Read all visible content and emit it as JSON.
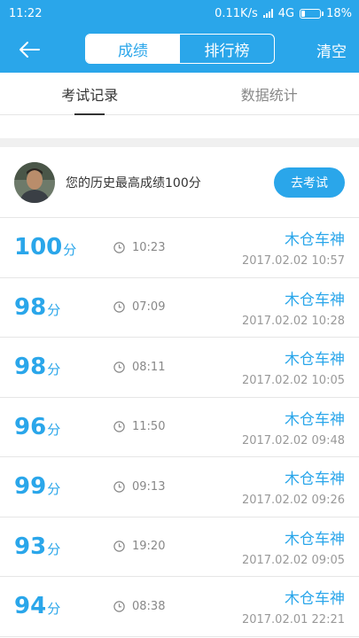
{
  "status": {
    "time": "11:22",
    "speed": "0.11K/s",
    "network": "4G",
    "battery": "18%",
    "battery_level": 0.18
  },
  "header": {
    "tab_active": "成绩",
    "tab_inactive": "排行榜",
    "clear": "清空"
  },
  "tabs": {
    "records": "考试记录",
    "stats": "数据统计"
  },
  "best": {
    "text": "您的历史最高成绩100分",
    "button": "去考试"
  },
  "records": [
    {
      "score": "100",
      "unit": "分",
      "duration": "10:23",
      "name": "木仓车神",
      "date": "2017.02.02  10:57"
    },
    {
      "score": "98",
      "unit": "分",
      "duration": "07:09",
      "name": "木仓车神",
      "date": "2017.02.02  10:28"
    },
    {
      "score": "98",
      "unit": "分",
      "duration": "08:11",
      "name": "木仓车神",
      "date": "2017.02.02  10:05"
    },
    {
      "score": "96",
      "unit": "分",
      "duration": "11:50",
      "name": "木仓车神",
      "date": "2017.02.02  09:48"
    },
    {
      "score": "99",
      "unit": "分",
      "duration": "09:13",
      "name": "木仓车神",
      "date": "2017.02.02  09:26"
    },
    {
      "score": "93",
      "unit": "分",
      "duration": "19:20",
      "name": "木仓车神",
      "date": "2017.02.02  09:05"
    },
    {
      "score": "94",
      "unit": "分",
      "duration": "08:38",
      "name": "木仓车神",
      "date": "2017.02.01  22:21"
    }
  ]
}
